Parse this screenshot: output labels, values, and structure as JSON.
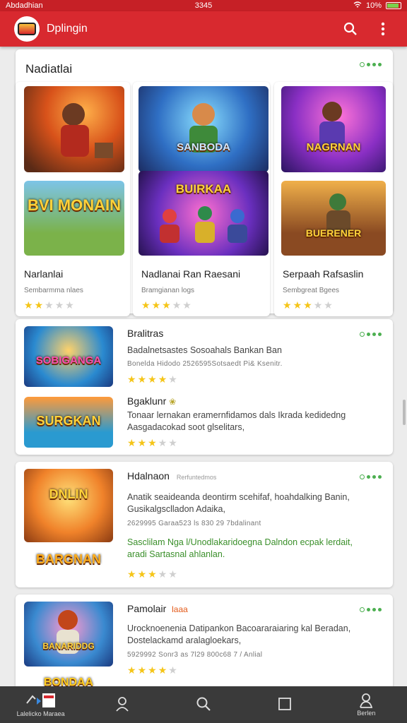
{
  "status_bar": {
    "left": "Abdadhian",
    "center": "3345",
    "right": "10%"
  },
  "app_bar": {
    "title": "Dplingin",
    "colors": {
      "primary": "#d8292f"
    }
  },
  "featured": {
    "title": "Nadiatlai",
    "columns": [
      {
        "name": "Narlanlai",
        "sub": "Sembarmma nlaes",
        "rating": 2,
        "thumbs": [
          {
            "caption": ""
          },
          {
            "caption": "BVI MONAIN"
          }
        ]
      },
      {
        "name": "Nadlanai Ran Raesani",
        "sub": "Bramgianan logs",
        "rating": 3,
        "thumbs": [
          {
            "caption": "SANBODA"
          },
          {
            "caption": "BUIRKAA"
          }
        ]
      },
      {
        "name": "Serpaah Rafsaslin",
        "sub": "Sembgreat Bgees",
        "rating": 3,
        "thumbs": [
          {
            "caption": "NAGRNAN"
          },
          {
            "caption": "BUERENER"
          }
        ]
      }
    ]
  },
  "list": [
    {
      "title": "Bralitras",
      "line1": "Badalnetsastes Sosoahals Bankan Ban",
      "meta": "Bonelda Hidodo 2526595Sotsaedt Pi& Ksenitr.",
      "rating": 4,
      "thumb_caption": "SOBIGANGA",
      "sub_title": "Bgaklunr",
      "sub_text": [
        "Tonaar lernakan eramernfidamos dals Ikrada kedidedng",
        "Aasgadacokad soot glselitars,"
      ],
      "sub_rating": 3,
      "sub_thumb_caption": "SURGKAN"
    },
    {
      "title": "Hdalnaon",
      "tag": "Rerfuntedmos",
      "line1": "Anatik seaideanda deontirm scehifaf, hoahdalking Banin,",
      "line2": "Gusikalgsclladon Adaika,",
      "meta": "2629995 Garaa523 ls 830 29 7bdalinant",
      "green": [
        "Sasclilam Nga l/Unodlakaridoegna Dalndon ecpak lerdait,",
        "aradi Sartasnal ahlanlan."
      ],
      "rating": 3,
      "thumb_caption": "DNLIN",
      "logo_caption": "BARGNAN"
    },
    {
      "title": "Pamolair",
      "tag": "laaa",
      "line1": "Urocknoenenia Datipankon Bacoararaiaring kal Beradan,",
      "line2": "Dostelackamd aralagloekars,",
      "meta": "5929992 Sonr3 as 7l29 800c68 7 / Anlial",
      "rating": 4,
      "thumb_caption": "BANARIDDG",
      "logo_caption": "BONDAA"
    }
  ],
  "bottom_nav": [
    {
      "label": "Lalelicko Maraea",
      "icon": "home-icon"
    },
    {
      "label": "",
      "icon": "profile-icon"
    },
    {
      "label": "",
      "icon": "search-icon"
    },
    {
      "label": "",
      "icon": "square-icon"
    },
    {
      "label": "Berlen",
      "icon": "account-icon"
    }
  ]
}
